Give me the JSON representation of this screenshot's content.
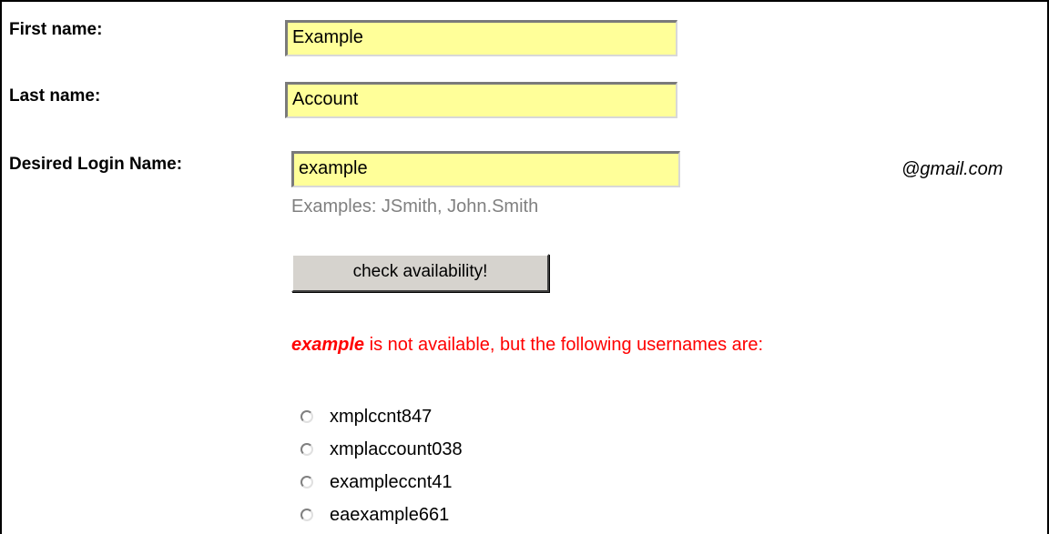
{
  "form": {
    "first_name_label": "First name:",
    "first_name_value": "Example",
    "last_name_label": "Last name:",
    "last_name_value": "Account",
    "login_label": "Desired Login Name:",
    "login_value": "example",
    "domain_suffix": "@gmail.com",
    "login_hint": "Examples: JSmith, John.Smith",
    "check_button_label": "check availability!"
  },
  "availability": {
    "requested_name": "example",
    "message_rest": " is not available, but the following usernames are:",
    "suggestions": [
      "xmplccnt847",
      "xmplaccount038",
      "exampleccnt41",
      "eaexample661"
    ]
  },
  "colors": {
    "input_background": "#ffff99",
    "error_text": "#ff0000",
    "hint_text": "#808080",
    "button_face": "#d6d3ce"
  }
}
